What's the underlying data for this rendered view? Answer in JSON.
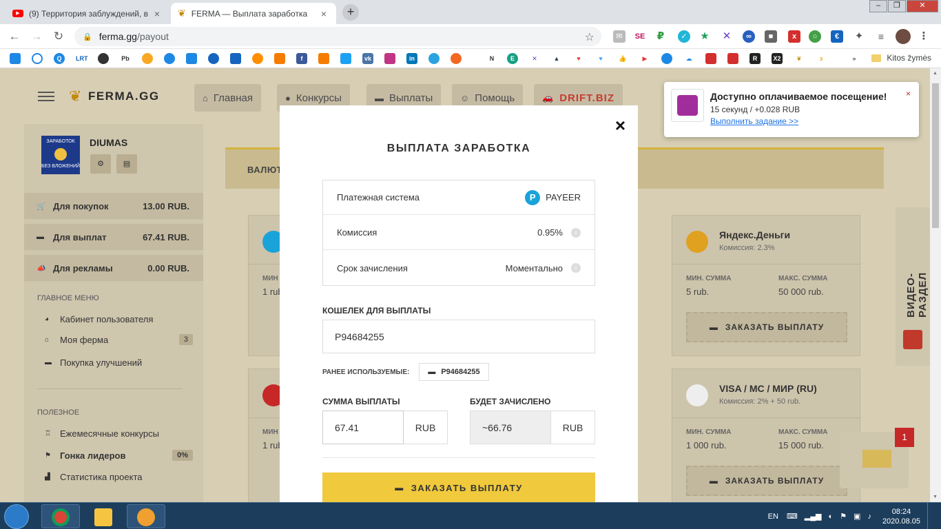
{
  "browser": {
    "tabs": [
      {
        "title": "(9) Территория заблуждений, в",
        "icon": "youtube-icon",
        "color": "#ff0000"
      },
      {
        "title": "FERMA — Выплата заработка",
        "icon": "wheat-icon",
        "color": "#c18a0d"
      }
    ],
    "new_tab_symbol": "+",
    "url_host": "ferma.gg",
    "url_path": "/payout",
    "bookmark_folder": "Kitos žymės",
    "bookmarks_more": "»"
  },
  "site": {
    "logo": "FERMA.GG",
    "nav": [
      {
        "label": "Главная",
        "icon": "home-icon"
      },
      {
        "label": "Конкурсы",
        "icon": "trophy-icon"
      },
      {
        "label": "Выплаты",
        "icon": "wallet-icon"
      },
      {
        "label": "Помощь",
        "icon": "support-icon"
      },
      {
        "label": "DRIFT.BIZ",
        "icon": "car-icon"
      }
    ]
  },
  "user": {
    "name": "DIUMAS",
    "avatar_text_top": "ЗАРАБОТОК",
    "avatar_text_bottom": "БЕЗ ВЛОЖЕНИЙ",
    "balances": [
      {
        "label": "Для покупок",
        "value": "13.00 RUB."
      },
      {
        "label": "Для выплат",
        "value": "67.41 RUB."
      },
      {
        "label": "Для рекламы",
        "value": "0.00 RUB."
      }
    ]
  },
  "menu": {
    "main_header": "ГЛАВНОЕ МЕНЮ",
    "main_items": [
      {
        "label": "Кабинет пользователя",
        "count": ""
      },
      {
        "label": "Моя ферма",
        "count": "3"
      },
      {
        "label": "Покупка улучшений",
        "count": ""
      }
    ],
    "useful_header": "ПОЛЕЗНОЕ",
    "useful_items": [
      {
        "label": "Ежемесячные конкурсы",
        "count": ""
      },
      {
        "label": "Гонка лидеров",
        "count": "0%"
      },
      {
        "label": "Статистика проекта",
        "count": ""
      }
    ]
  },
  "content": {
    "heading_partial": "ВАЛЮТ",
    "cards": [
      {
        "name": "",
        "commission": "",
        "min_label": "МИН",
        "min": "1 rub",
        "max_label": "",
        "max": "",
        "color": "#1aa3d9"
      },
      {
        "name": "Яндекс.Деньги",
        "commission": "Комиссия: 2.3%",
        "min_label": "МИН. СУММА",
        "min": "5 rub.",
        "max_label": "МАКС. СУММА",
        "max": "50 000 rub.",
        "button": "ЗАКАЗАТЬ ВЫПЛАТУ",
        "color": "#e0a020"
      },
      {
        "name": "",
        "commission": "",
        "min_label": "МИН",
        "min": "1 rub",
        "max_label": "",
        "max": "",
        "color": "#c62828"
      },
      {
        "name": "VISA / MC / МИР (RU)",
        "commission": "Комиссия: 2% + 50 rub.",
        "min_label": "МИН. СУММА",
        "min": "1 000 rub.",
        "max_label": "МАКС. СУММА",
        "max": "15 000 rub.",
        "button": "ЗАКАЗАТЬ ВЫПЛАТУ",
        "color": "#eeeeee"
      }
    ],
    "side_tab": "ВИДЕО-РАЗДЕЛ",
    "mail_badge": "1"
  },
  "notification": {
    "title": "Доступно оплачиваемое посещение!",
    "subtitle": "15 секунд / +0.028 RUB",
    "link": "Выполнить задание >>",
    "close": "×"
  },
  "modal": {
    "close": "×",
    "title": "ВЫПЛАТА ЗАРАБОТКА",
    "rows": [
      {
        "key": "Платежная система",
        "value": "PAYEER"
      },
      {
        "key": "Комиссия",
        "value": "0.95%"
      },
      {
        "key": "Срок зачисления",
        "value": "Моментально"
      }
    ],
    "payeer_letter": "P",
    "wallet_label": "КОШЕЛЕК ДЛЯ ВЫПЛАТЫ",
    "wallet_value": "P94684255",
    "previous_label": "РАНЕЕ ИСПОЛЬЗУЕМЫЕ:",
    "previous_wallet": "P94684255",
    "amount_label": "СУММА ВЫПЛАТЫ",
    "amount_value": "67.41",
    "amount_unit": "RUB",
    "credited_label": "БУДЕТ ЗАЧИСЛЕНО",
    "credited_value": "~66.76",
    "credited_unit": "RUB",
    "submit": "ЗАКАЗАТЬ ВЫПЛАТУ"
  },
  "taskbar": {
    "lang": "EN",
    "time": "08:24",
    "date": "2020.08.05"
  }
}
